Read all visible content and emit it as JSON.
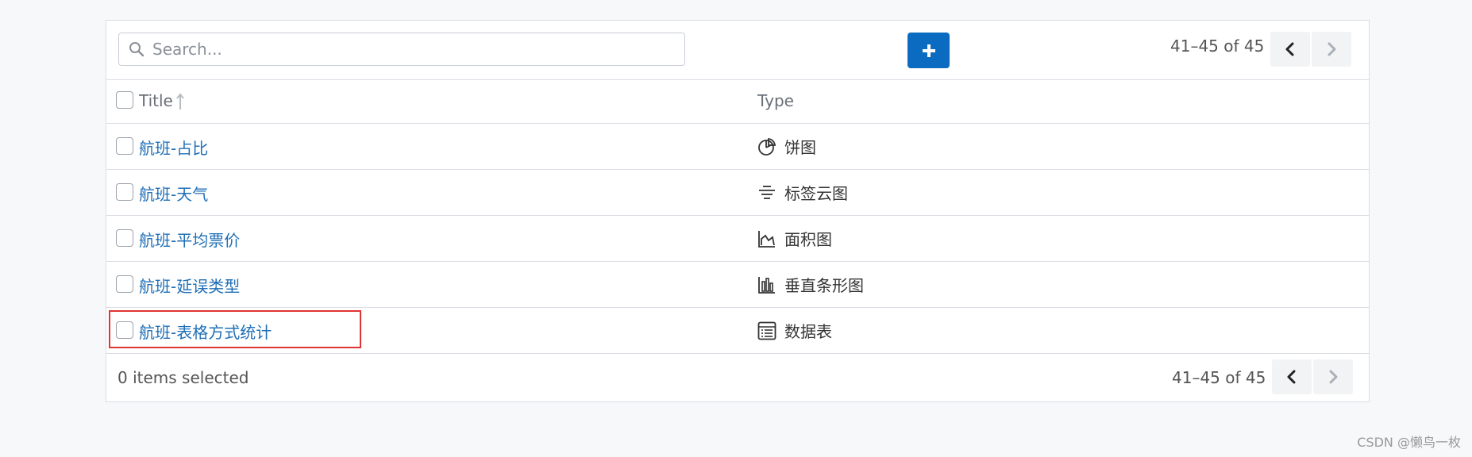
{
  "toolbar": {
    "search_placeholder": "Search...",
    "range_text": "41–45 of 45"
  },
  "table": {
    "columns": {
      "title": "Title",
      "type": "Type"
    },
    "rows": [
      {
        "title": "航班-占比",
        "type": "饼图",
        "type_icon": "pie-chart-icon"
      },
      {
        "title": "航班-天气",
        "type": "标签云图",
        "type_icon": "tag-cloud-icon"
      },
      {
        "title": "航班-平均票价",
        "type": "面积图",
        "type_icon": "area-chart-icon"
      },
      {
        "title": "航班-延误类型",
        "type": "垂直条形图",
        "type_icon": "bar-chart-icon"
      },
      {
        "title": "航班-表格方式统计",
        "type": "数据表",
        "type_icon": "data-table-icon"
      }
    ]
  },
  "footer": {
    "selected_text": "0 items selected",
    "range_text": "41–45 of 45"
  },
  "colors": {
    "link": "#1f6fb7",
    "primary_button": "#0a6bc1",
    "highlight_border": "#e03333"
  },
  "watermark": "CSDN @懒鸟一枚"
}
